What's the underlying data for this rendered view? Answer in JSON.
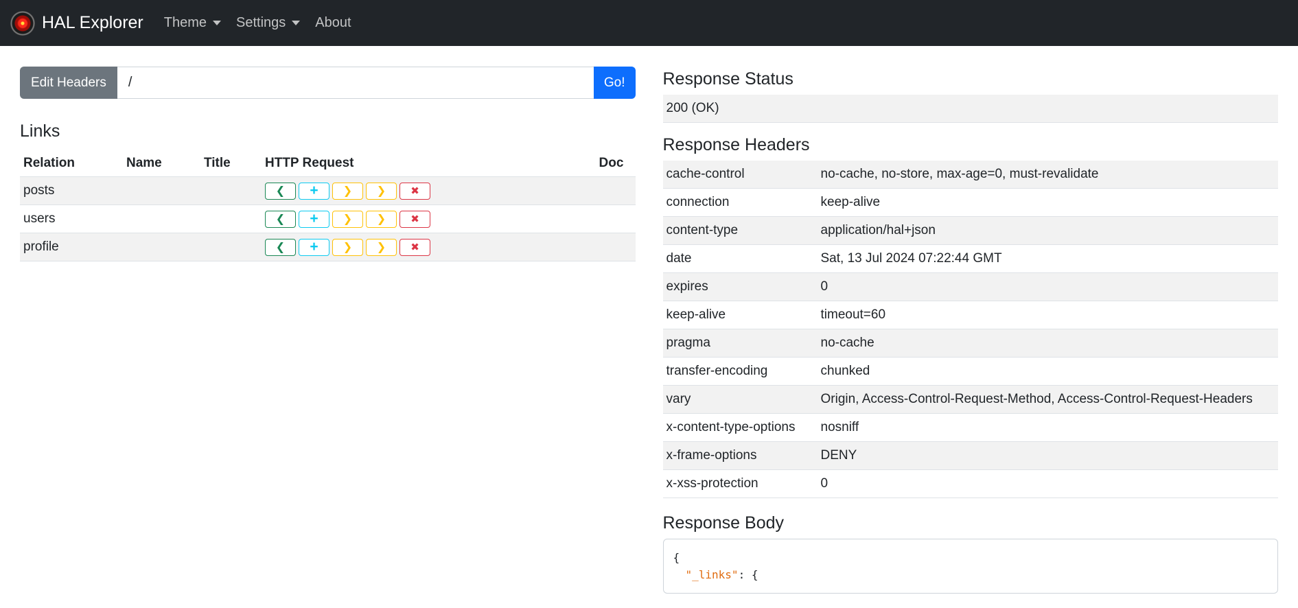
{
  "navbar": {
    "title": "HAL Explorer",
    "logo_icon": "hal-9000-eye-icon",
    "menu": [
      {
        "label": "Theme",
        "dropdown": true
      },
      {
        "label": "Settings",
        "dropdown": true
      },
      {
        "label": "About",
        "dropdown": false
      }
    ]
  },
  "request": {
    "edit_headers_label": "Edit Headers",
    "uri_value": "/",
    "go_label": "Go!"
  },
  "links": {
    "title": "Links",
    "columns": [
      "Relation",
      "Name",
      "Title",
      "HTTP Request",
      "Doc"
    ],
    "rows": [
      {
        "relation": "posts",
        "name": "",
        "title": ""
      },
      {
        "relation": "users",
        "name": "",
        "title": ""
      },
      {
        "relation": "profile",
        "name": "",
        "title": ""
      }
    ],
    "request_buttons": [
      {
        "method": "GET",
        "icon": "chevron-left-icon",
        "glyph": "❮",
        "color": "#198754"
      },
      {
        "method": "POST",
        "icon": "plus-icon",
        "glyph": "+",
        "color": "#0dcaf0"
      },
      {
        "method": "PUT",
        "icon": "chevron-right-icon",
        "glyph": "❯",
        "color": "#ffc107"
      },
      {
        "method": "PATCH",
        "icon": "chevron-right-icon",
        "glyph": "❯",
        "color": "#ffc107"
      },
      {
        "method": "DELETE",
        "icon": "x-icon",
        "glyph": "✖",
        "color": "#dc3545"
      }
    ]
  },
  "response": {
    "status_title": "Response Status",
    "status_value": "200 (OK)",
    "headers_title": "Response Headers",
    "headers": [
      {
        "name": "cache-control",
        "value": "no-cache, no-store, max-age=0, must-revalidate"
      },
      {
        "name": "connection",
        "value": "keep-alive"
      },
      {
        "name": "content-type",
        "value": "application/hal+json"
      },
      {
        "name": "date",
        "value": "Sat, 13 Jul 2024 07:22:44 GMT"
      },
      {
        "name": "expires",
        "value": "0"
      },
      {
        "name": "keep-alive",
        "value": "timeout=60"
      },
      {
        "name": "pragma",
        "value": "no-cache"
      },
      {
        "name": "transfer-encoding",
        "value": "chunked"
      },
      {
        "name": "vary",
        "value": "Origin, Access-Control-Request-Method, Access-Control-Request-Headers"
      },
      {
        "name": "x-content-type-options",
        "value": "nosniff"
      },
      {
        "name": "x-frame-options",
        "value": "DENY"
      },
      {
        "name": "x-xss-protection",
        "value": "0"
      }
    ],
    "body_title": "Response Body",
    "body_lines": [
      "{",
      "\"_links\"",
      ": {"
    ]
  }
}
